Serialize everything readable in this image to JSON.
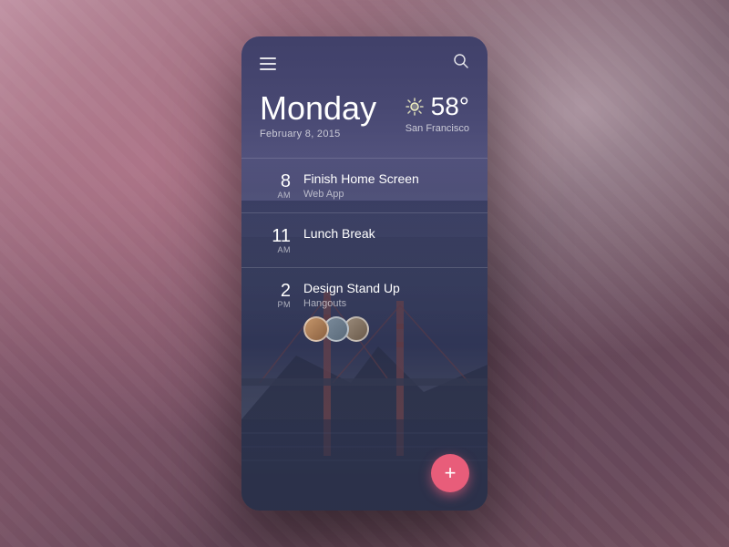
{
  "background": {
    "color": "#7a5a6a"
  },
  "header": {
    "menu_icon": "hamburger-icon",
    "search_icon": "search-icon"
  },
  "date": {
    "day": "Monday",
    "full": "February 8, 2015"
  },
  "weather": {
    "temp": "58°",
    "city": "San Francisco",
    "icon": "sun-icon"
  },
  "schedule": [
    {
      "hour": "8",
      "ampm": "AM",
      "title": "Finish Home Screen",
      "subtitle": "Web App",
      "avatars": []
    },
    {
      "hour": "11",
      "ampm": "AM",
      "title": "Lunch Break",
      "subtitle": "",
      "avatars": []
    },
    {
      "hour": "2",
      "ampm": "PM",
      "title": "Design Stand Up",
      "subtitle": "Hangouts",
      "avatars": [
        "person1",
        "person2",
        "person3"
      ]
    }
  ],
  "fab": {
    "label": "+"
  }
}
